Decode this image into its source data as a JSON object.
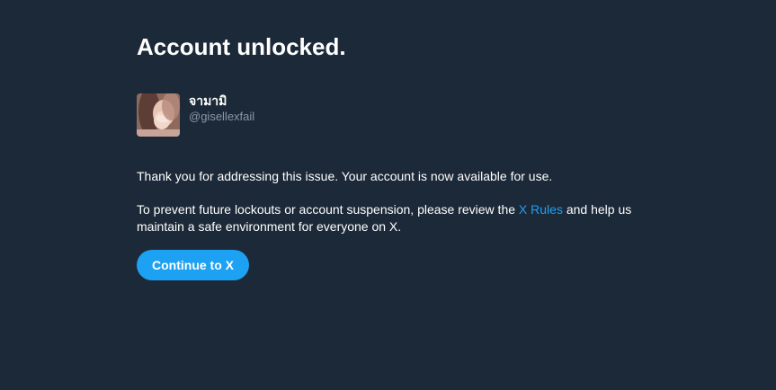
{
  "page": {
    "title": "Account unlocked."
  },
  "user": {
    "display_name": "จามามิ",
    "handle": "@gisellexfail",
    "avatar_icon": "profile-photo"
  },
  "message": {
    "line1": "Thank you for addressing this issue. Your account is now available for use.",
    "line2_before": "To prevent future lockouts or account suspension, please review the ",
    "rules_link": "X Rules",
    "line2_after": " and help us maintain a safe environment for everyone on X."
  },
  "actions": {
    "continue_label": "Continue to X"
  },
  "colors": {
    "background": "#1c2938",
    "accent": "#1da1f2",
    "secondary_text": "#8899a6"
  }
}
